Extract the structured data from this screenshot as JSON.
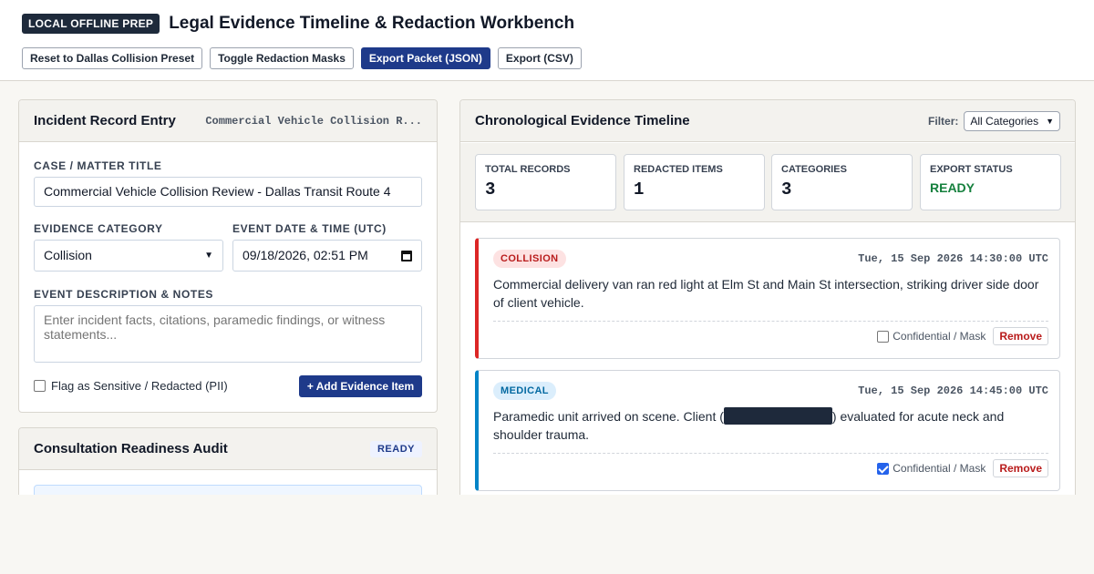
{
  "app": {
    "badge": "LOCAL OFFLINE PREP",
    "title": "Legal Evidence Timeline & Redaction Workbench"
  },
  "toolbar": {
    "reset_label": "Reset to Dallas Collision Preset",
    "toggle_label": "Toggle Redaction Masks",
    "export_json_label": "Export Packet (JSON)",
    "export_csv_label": "Export (CSV)"
  },
  "entry": {
    "title": "Incident Record Entry",
    "case_tag": "Commercial Vehicle Collision R...",
    "case_label": "CASE / MATTER TITLE",
    "case_value": "Commercial Vehicle Collision Review - Dallas Transit Route 4",
    "category_label": "EVIDENCE CATEGORY",
    "category_value": "Collision",
    "datetime_label": "EVENT DATE & TIME (UTC)",
    "datetime_value": "09/18/2026, 02:51 PM",
    "desc_label": "EVENT DESCRIPTION & NOTES",
    "desc_placeholder": "Enter incident facts, citations, paramedic findings, or witness statements...",
    "flag_label": "Flag as Sensitive / Redacted (PII)",
    "flag_checked": false,
    "add_label": "+ Add Evidence Item"
  },
  "audit": {
    "title": "Consultation Readiness Audit",
    "status": "READY"
  },
  "timeline": {
    "title": "Chronological Evidence Timeline",
    "filter_label": "Filter:",
    "filter_value": "All Categories",
    "stats": [
      {
        "label": "TOTAL RECORDS",
        "value": "3"
      },
      {
        "label": "REDACTED ITEMS",
        "value": "1"
      },
      {
        "label": "CATEGORIES",
        "value": "3"
      },
      {
        "label": "EXPORT STATUS",
        "value": "READY"
      }
    ],
    "items": [
      {
        "category": "COLLISION",
        "time": "Tue, 15 Sep 2026 14:30:00 UTC",
        "text": "Commercial delivery van ran red light at Elm St and Main St intersection, striking driver side door of client vehicle.",
        "mask_label": "Confidential / Mask",
        "masked": false,
        "remove_label": "Remove"
      },
      {
        "category": "MEDICAL",
        "time": "Tue, 15 Sep 2026 14:45:00 UTC",
        "text_before": "Paramedic unit arrived on scene. Client (",
        "text_after": ") evaluated for acute neck and shoulder trauma.",
        "mask_label": "Confidential / Mask",
        "masked": true,
        "remove_label": "Remove"
      }
    ]
  },
  "colors": {
    "primary": "#1e3a8a",
    "collision": "#dc2626",
    "medical": "#0284c7",
    "ready_green": "#15803d",
    "redaction": "#1e293b"
  }
}
